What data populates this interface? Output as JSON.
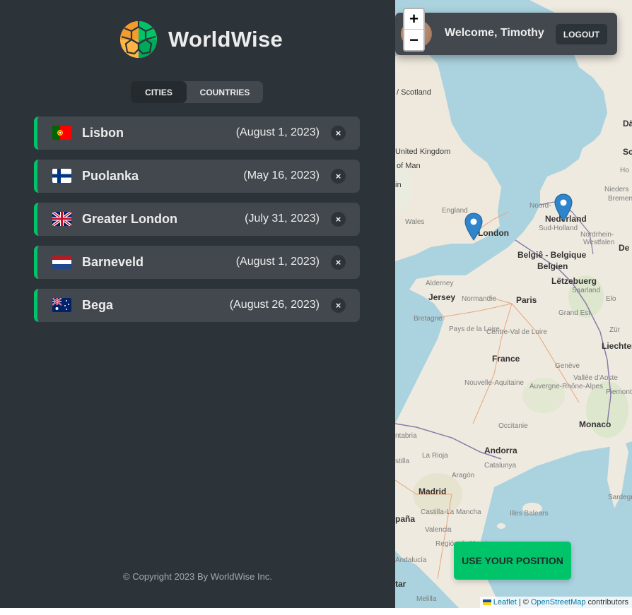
{
  "app": {
    "name": "WorldWise"
  },
  "tabs": [
    {
      "label": "CITIES",
      "active": true
    },
    {
      "label": "COUNTRIES",
      "active": false
    }
  ],
  "cities": [
    {
      "flag": "portugal-flag",
      "name": "Lisbon",
      "date": "(August 1, 2023)"
    },
    {
      "flag": "finland-flag",
      "name": "Puolanka",
      "date": "(May 16, 2023)"
    },
    {
      "flag": "uk-flag",
      "name": "Greater London",
      "date": "(July 31, 2023)"
    },
    {
      "flag": "netherlands-flag",
      "name": "Barneveld",
      "date": "(August 1, 2023)"
    },
    {
      "flag": "australia-flag",
      "name": "Bega",
      "date": "(August 26, 2023)"
    }
  ],
  "delete_label": "×",
  "footer": {
    "copyright": "© Copyright 2023 By WorldWise Inc."
  },
  "map": {
    "zoom_in": "+",
    "zoom_out": "−",
    "user": {
      "welcome": "Welcome, Timothy",
      "logout": "LOGOUT"
    },
    "position_button": "USE YOUR POSITION",
    "attribution": {
      "leaflet": "Leaflet",
      "separator": "| ©",
      "osm": "OpenStreetMap",
      "suffix": "contributors"
    },
    "labels": [
      "/ Scotland",
      "United Kingdom",
      "of Man",
      "in",
      "England",
      "Wales",
      "London",
      "Noord-",
      "Nederland",
      "Nordrhein-",
      "Westfalen",
      "Belgiê - Belgique",
      "Belgien",
      "Lëtzebuerg",
      "Saarland",
      "Alderney",
      "Jersey",
      "Normandie",
      "Paris",
      "Bretagne",
      "Grand Est",
      "Pays de la Loire",
      "Centre-Val de Loire",
      "France",
      "Nouvelle-Aquitaine",
      "Auvergne-Rhône-Alpes",
      "Occitanie",
      "Monaco",
      "Andorra",
      "Catalunya",
      "Aragón",
      "La Rioja",
      "Madrid",
      "Castilla-La Mancha",
      "Illes Balears",
      "Región de Murcia",
      "Andalucía",
      "ntabria",
      "stilla",
      "paña",
      "tar",
      "Melilla",
      "Sardegna",
      "Liechtenstein",
      "Dä",
      "Sc",
      "Ho",
      "Bremen",
      "Nieders",
      "De",
      "Piemonte",
      "Genève",
      "Vallée d'Aoste",
      "Sud-Holland",
      "Valencia",
      "Elo",
      "Zür"
    ],
    "markers": [
      "London",
      "Netherlands"
    ]
  }
}
